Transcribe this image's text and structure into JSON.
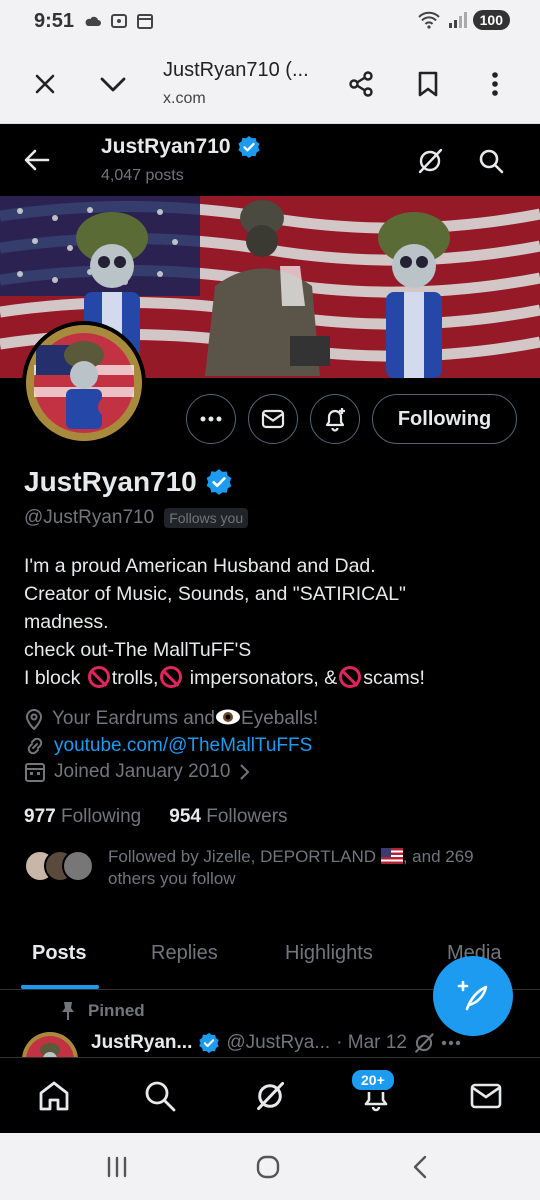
{
  "status_bar": {
    "time": "9:51",
    "battery": "100"
  },
  "browser": {
    "page_title": "JustRyan710 (...",
    "url": "x.com"
  },
  "profile_header": {
    "name": "JustRyan710",
    "post_count": "4,047 posts"
  },
  "profile": {
    "display_name": "JustRyan710",
    "handle": "@JustRyan710",
    "follows_you": "Follows you",
    "following_button": "Following",
    "bio_lines": [
      "I'm a proud American Husband and Dad.",
      "Creator of Music, Sounds, and \"SATIRICAL\"",
      "madness.",
      "check out-The MallTuFF'S"
    ],
    "bio_block": {
      "prefix": "I block ",
      "t1": "trolls,",
      "t2": " impersonators, &",
      "t3": "scams!"
    },
    "location_prefix": "Your Eardrums and",
    "location_suffix": "Eyeballs!",
    "website": "youtube.com/@TheMallTuFFS",
    "joined": "Joined January 2010",
    "following_count": "977",
    "following_label": "Following",
    "followers_count": "954",
    "followers_label": "Followers",
    "followed_by": "Followed by Jizelle, DEPORTLAND",
    "followed_by_rest": ", and 269",
    "followed_by_line2": "others you follow"
  },
  "tabs": [
    "Posts",
    "Replies",
    "Highlights",
    "Media"
  ],
  "pinned_post": {
    "pinned_label": "Pinned",
    "author": "JustRyan...",
    "handle": "@JustRya...",
    "date": "· Mar 12"
  },
  "bottom_nav": {
    "notifications_badge": "20+"
  },
  "colors": {
    "accent": "#1d9bf0",
    "background": "#000000",
    "muted": "#71767b"
  }
}
